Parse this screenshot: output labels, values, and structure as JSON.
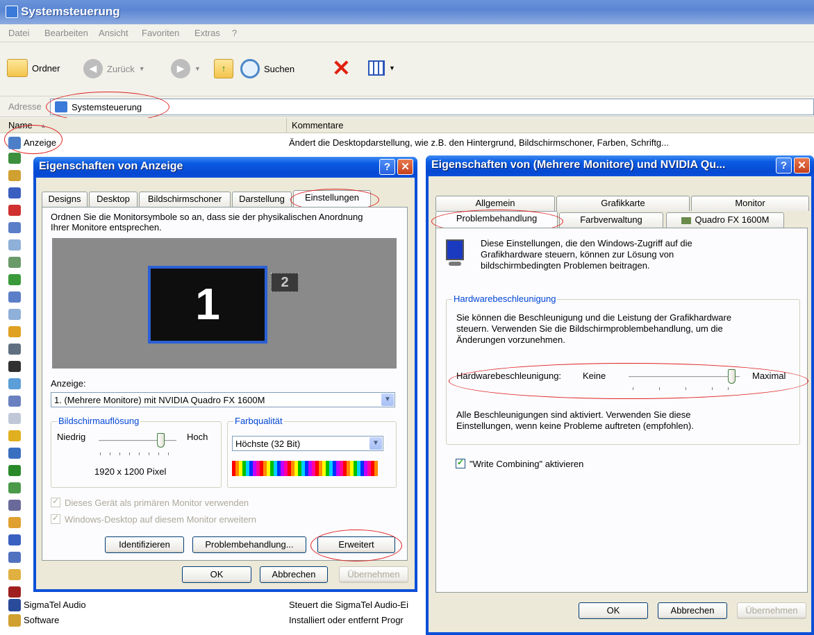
{
  "window": {
    "title": "Systemsteuerung"
  },
  "menu": [
    "Datei",
    "Bearbeiten",
    "Ansicht",
    "Favoriten",
    "Extras",
    "?"
  ],
  "toolbar": {
    "folders": "Ordner",
    "back": "Zurück",
    "search": "Suchen"
  },
  "address": {
    "label": "Adresse",
    "value": "Systemsteuerung"
  },
  "list": {
    "col_name": "Name",
    "col_comment": "Kommentare",
    "rows": [
      {
        "name": "Anzeige",
        "comment": "Ändert die Desktopdarstellung, wie z.B. den Hintergrund, Bildschirmschoner, Farben, Schriftg..."
      },
      {
        "name": "SigmaTel Audio",
        "comment": "Steuert die SigmaTel Audio-Ei"
      },
      {
        "name": "Software",
        "comment": "Installiert oder entfernt Progr"
      }
    ]
  },
  "dlg1": {
    "title": "Eigenschaften von Anzeige",
    "tabs": [
      "Designs",
      "Desktop",
      "Bildschirmschoner",
      "Darstellung",
      "Einstellungen"
    ],
    "instruction": "Ordnen Sie die Monitorsymbole so an, dass sie der physikalischen Anordnung",
    "instruction2": "Ihrer Monitore entsprechen.",
    "monitor1": "1",
    "monitor2": "2",
    "display_label": "Anzeige:",
    "display_value": "1. (Mehrere Monitore) mit NVIDIA Quadro FX 1600M",
    "resolution": {
      "label": "Bildschirmauflösung",
      "low": "Niedrig",
      "high": "Hoch",
      "value": "1920 x 1200 Pixel"
    },
    "color": {
      "label": "Farbqualität",
      "value": "Höchste (32 Bit)"
    },
    "chk_primary": "Dieses Gerät als primären Monitor verwenden",
    "chk_extend": "Windows-Desktop auf diesem Monitor erweitern",
    "btn_identify": "Identifizieren",
    "btn_trouble": "Problembehandlung...",
    "btn_advanced": "Erweitert",
    "btn_ok": "OK",
    "btn_cancel": "Abbrechen",
    "btn_apply": "Übernehmen"
  },
  "dlg2": {
    "title": "Eigenschaften von (Mehrere Monitore) und NVIDIA Qu...",
    "tabs_row1": [
      "Allgemein",
      "Grafikkarte",
      "Monitor"
    ],
    "tabs_row2": [
      "Problembehandlung",
      "Farbverwaltung",
      "Quadro FX 1600M"
    ],
    "intro1": "Diese Einstellungen, die den Windows-Zugriff auf die",
    "intro2": "Grafikhardware steuern, können zur Lösung von",
    "intro3": "bildschirmbedingten Problemen beitragen.",
    "group_label": "Hardwarebeschleunigung",
    "desc1": "Sie können die Beschleunigung und die Leistung der Grafikhardware",
    "desc2": "steuern. Verwenden Sie die Bildschirmproblembehandlung, um die",
    "desc3": "Änderungen vorzunehmen.",
    "slider_label": "Hardwarebeschleunigung:",
    "slider_min": "Keine",
    "slider_max": "Maximal",
    "slider_level": 1.0,
    "status1": "Alle Beschleunigungen sind aktiviert. Verwenden Sie diese",
    "status2": "Einstellungen, wenn keine Probleme auftreten (empfohlen).",
    "chk_write": "\"Write Combining\" aktivieren",
    "btn_ok": "OK",
    "btn_cancel": "Abbrechen",
    "btn_apply": "Übernehmen"
  },
  "colors": {
    "title_blue": "#0a50da",
    "highlight_red": "#e02020",
    "dialog_bg": "#ece9d8"
  }
}
